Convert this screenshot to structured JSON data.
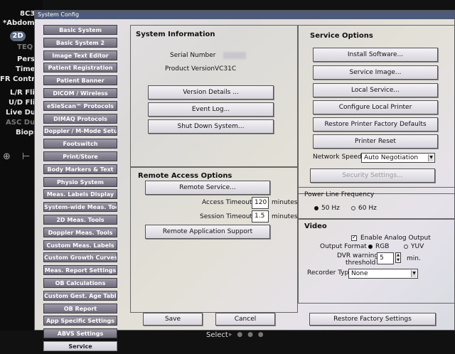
{
  "background": {
    "lines": [
      "8C3",
      "*Abdome",
      "TEQ",
      "Persis",
      "Timer",
      "FR Control",
      "L/R Flip",
      "U/D Flip",
      "Live Dual",
      "ASC Dual",
      "Biopsy"
    ],
    "mode_badge": "2D",
    "select_label": "Select"
  },
  "window": {
    "title": "System Config"
  },
  "tabs": [
    "Basic System",
    "Basic System 2",
    "Image Text Editor",
    "Patient Registration",
    "Patient Banner",
    "DICOM / Wireless",
    "eSieScan™ Protocols",
    "DIMAQ Protocols",
    "Doppler / M-Mode Setup",
    "Footswitch",
    "Print/Store",
    "Body Markers & Text",
    "Physio System",
    "Meas. Labels Display",
    "System-wide Meas. Tools",
    "2D Meas. Tools",
    "Doppler Meas. Tools",
    "Custom Meas. Labels",
    "Custom Growth Curves",
    "Meas. Report Settings",
    "OB Calculations",
    "Custom Gest. Age Tables",
    "OB Report",
    "App Specific Settings",
    "ABVS Settings",
    "Service"
  ],
  "system_info": {
    "title": "System Information",
    "serial_label": "Serial Number",
    "version_label": "Product Version",
    "version_value": "VC31C",
    "buttons": [
      "Version Details ...",
      "Event Log...",
      "Shut Down System..."
    ]
  },
  "remote": {
    "title": "Remote Access Options",
    "service_button": "Remote Service...",
    "access_timeout_label": "Access Timeout",
    "access_timeout_value": "120",
    "session_timeout_label": "Session Timeout",
    "session_timeout_value": "1.5",
    "unit": "minutes",
    "support_button": "Remote Application Support"
  },
  "service_options": {
    "title": "Service Options",
    "buttons": [
      "Install Software...",
      "Service Image...",
      "Local Service...",
      "Configure Local Printer",
      "Restore Printer Factory Defaults",
      "Printer Reset"
    ],
    "network_speed_label": "Network Speed",
    "network_speed_value": "Auto Negotiation",
    "security_button": "Security Settings..."
  },
  "power": {
    "title": "Power Line Frequency",
    "option_50": "50 Hz",
    "option_60": "60 Hz",
    "selected": "50 Hz"
  },
  "video": {
    "title": "Video",
    "analog_label": "Enable Analog Output",
    "format_label": "Output Format",
    "rgb": "RGB",
    "yuv": "YUV",
    "dvr_label_1": "DVR warning",
    "dvr_label_2": "threshold",
    "dvr_value": "5",
    "dvr_unit": "min.",
    "recorder_label": "Recorder Type",
    "recorder_value": "None"
  },
  "footer": {
    "save": "Save",
    "cancel": "Cancel",
    "restore": "Restore Factory Settings"
  }
}
